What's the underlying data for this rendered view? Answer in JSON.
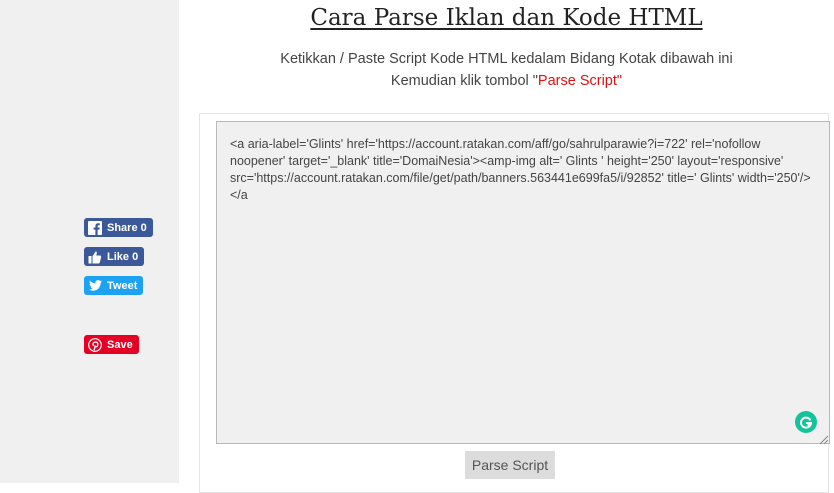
{
  "share": {
    "facebook_label": "Share 0",
    "like_label": "Like 0",
    "tweet_label": "Tweet",
    "pinterest_label": "Save"
  },
  "page": {
    "title": "Cara Parse Iklan dan Kode HTML",
    "instruction_line1": "Ketikkan / Paste Script Kode HTML kedalam Bidang Kotak dibawah ini",
    "instruction_line2_prefix": "Kemudian klik tombol \"",
    "instruction_line2_highlight": "Parse Script",
    "instruction_line2_suffix": "\""
  },
  "editor": {
    "value": "<a aria-label='Glints' href='https://account.ratakan.com/aff/go/sahrulparawie?i=722' rel='nofollow noopener' target='_blank' title='DomaiNesia'><amp-img alt=' Glints ' height='250' layout='responsive' src='https://account.ratakan.com/file/get/path/banners.563441e699fa5/i/92852' title=' Glints' width='250'/></a"
  },
  "buttons": {
    "parse_label": "Parse Script"
  },
  "icons": {
    "facebook": "facebook-icon",
    "like": "thumbs-up-icon",
    "twitter": "twitter-bird-icon",
    "pinterest": "pinterest-icon",
    "grammarly": "grammarly-icon",
    "resize": "resize-grip-icon"
  },
  "colors": {
    "facebook": "#3b5998",
    "twitter": "#1da1f2",
    "pinterest": "#e60023",
    "highlight": "#e01010",
    "grammarly": "#15c39a"
  }
}
